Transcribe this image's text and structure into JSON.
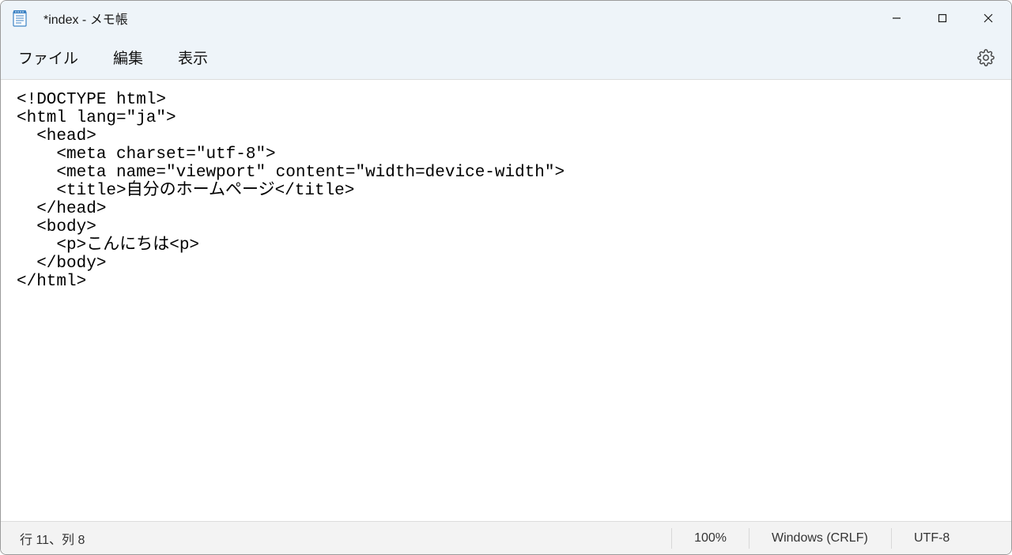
{
  "title": "*index - メモ帳",
  "menu": {
    "file": "ファイル",
    "edit": "編集",
    "view": "表示"
  },
  "editor_content": "<!DOCTYPE html>\n<html lang=\"ja\">\n  <head>\n    <meta charset=\"utf-8\">\n    <meta name=\"viewport\" content=\"width=device-width\">\n    <title>自分のホームページ</title>\n  </head>\n  <body>\n    <p>こんにちは<p>\n  </body>\n</html>",
  "status": {
    "cursor": "行 11、列 8",
    "zoom": "100%",
    "line_ending": "Windows (CRLF)",
    "encoding": "UTF-8"
  }
}
